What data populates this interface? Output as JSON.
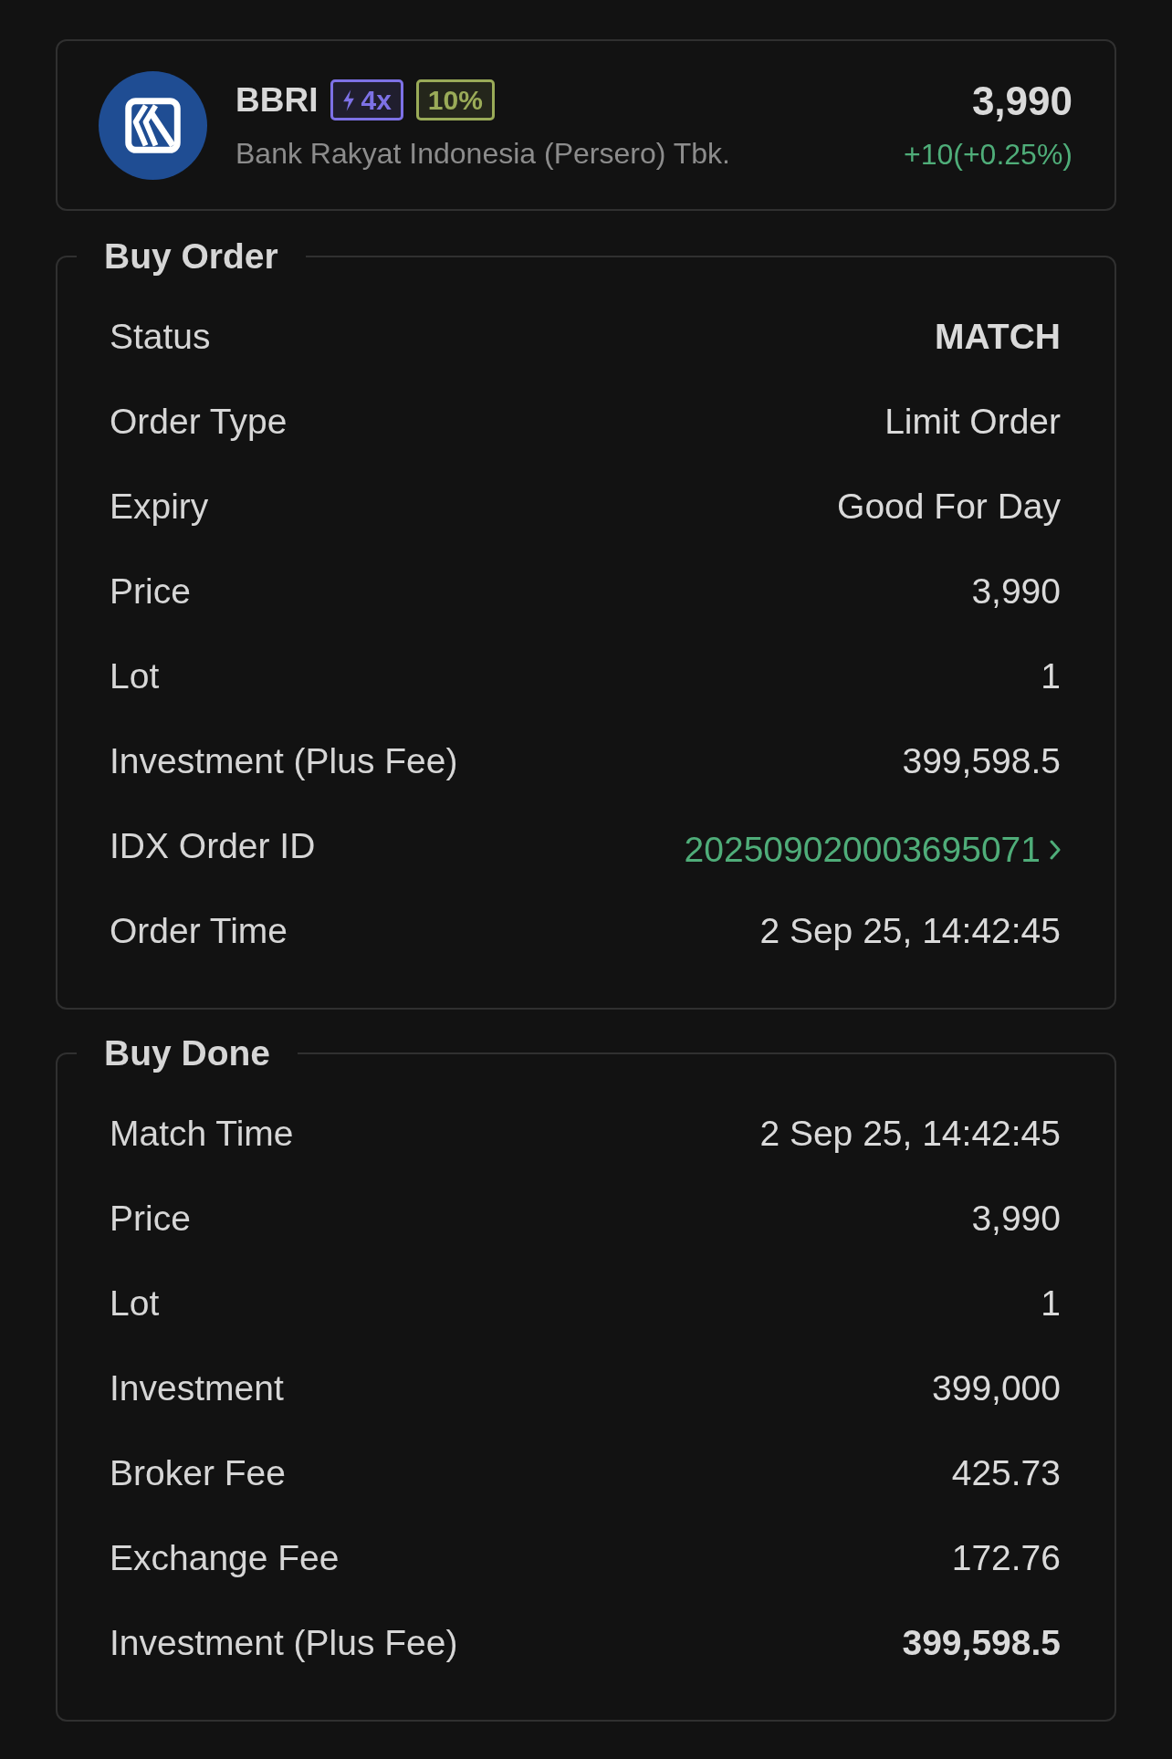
{
  "stock": {
    "ticker": "BBRI",
    "badges": [
      {
        "kind": "lightning",
        "text": "4x",
        "color": "#7d71e6"
      },
      {
        "kind": "plain",
        "text": "10%",
        "color": "#9aab58"
      }
    ],
    "name": "Bank Rakyat Indonesia (Persero) Tbk.",
    "price": "3,990",
    "change": "+10(+0.25%)"
  },
  "sections": [
    {
      "title": "Buy Order",
      "rows": [
        {
          "label": "Status",
          "value": "MATCH",
          "kind": "text",
          "bold": true
        },
        {
          "label": "Order Type",
          "value": "Limit Order",
          "kind": "text",
          "bold": false
        },
        {
          "label": "Expiry",
          "value": "Good For Day",
          "kind": "text",
          "bold": false
        },
        {
          "label": "Price",
          "value": "3,990",
          "kind": "text",
          "bold": false
        },
        {
          "label": "Lot",
          "value": "1",
          "kind": "text",
          "bold": false
        },
        {
          "label": "Investment (Plus Fee)",
          "value": "399,598.5",
          "kind": "text",
          "bold": false
        },
        {
          "label": "IDX Order ID",
          "value": "202509020003695071",
          "kind": "link",
          "bold": false
        },
        {
          "label": "Order Time",
          "value": "2 Sep 25, 14:42:45",
          "kind": "text",
          "bold": false
        }
      ]
    },
    {
      "title": "Buy Done",
      "rows": [
        {
          "label": "Match Time",
          "value": "2 Sep 25, 14:42:45",
          "kind": "text",
          "bold": false
        },
        {
          "label": "Price",
          "value": "3,990",
          "kind": "text",
          "bold": false
        },
        {
          "label": "Lot",
          "value": "1",
          "kind": "text",
          "bold": false
        },
        {
          "label": "Investment",
          "value": "399,000",
          "kind": "text",
          "bold": false
        },
        {
          "label": "Broker Fee",
          "value": "425.73",
          "kind": "text",
          "bold": false
        },
        {
          "label": "Exchange Fee",
          "value": "172.76",
          "kind": "text",
          "bold": false
        },
        {
          "label": "Investment (Plus Fee)",
          "value": "399,598.5",
          "kind": "text",
          "bold": true
        }
      ]
    }
  ]
}
